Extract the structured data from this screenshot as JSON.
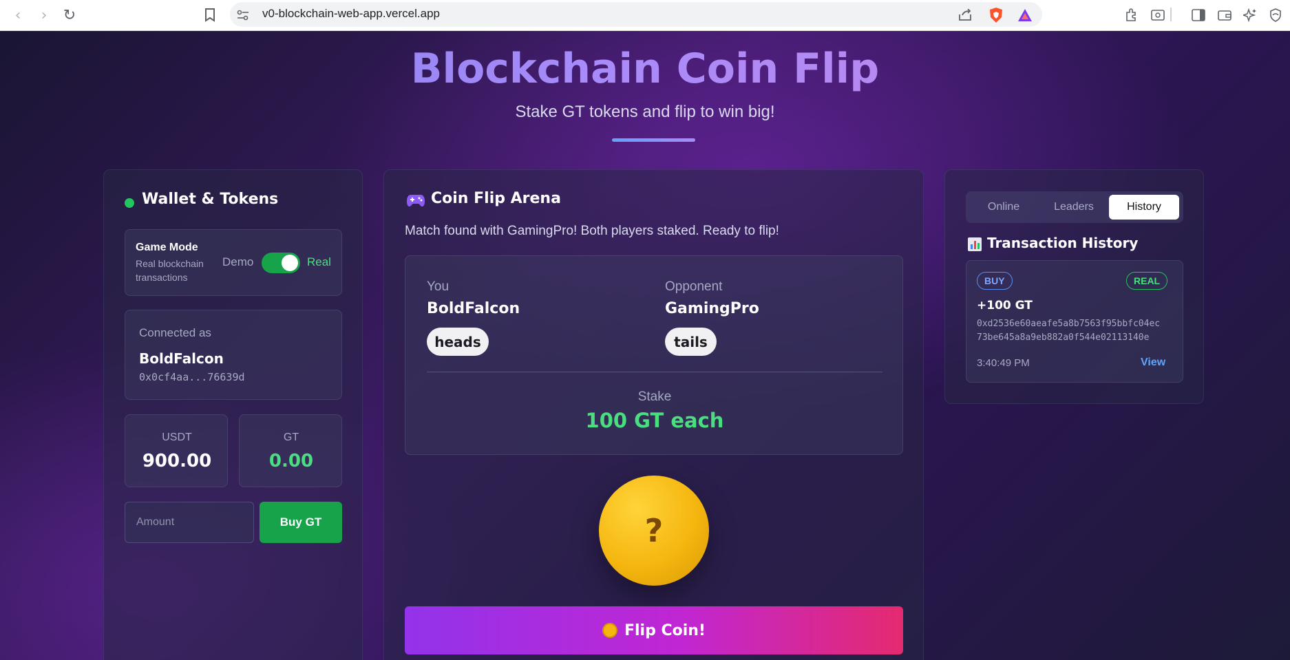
{
  "browser": {
    "url": "v0-blockchain-web-app.vercel.app"
  },
  "header": {
    "title": "Blockchain Coin Flip",
    "subtitle": "Stake GT tokens and flip to win big!"
  },
  "wallet": {
    "title": "Wallet & Tokens",
    "game_mode_label": "Game Mode",
    "game_mode_desc_line1": "Real blockchain",
    "game_mode_desc_line2": "transactions",
    "mode_demo": "Demo",
    "mode_real": "Real",
    "mode_is_real": true,
    "connected_label": "Connected as",
    "username": "BoldFalcon",
    "address": "0x0cf4aa...76639d",
    "usdt_label": "USDT",
    "usdt_value": "900.00",
    "gt_label": "GT",
    "gt_value": "0.00",
    "amount_placeholder": "Amount",
    "buy_label": "Buy GT"
  },
  "arena": {
    "title": "Coin Flip Arena",
    "status": "Match found with GamingPro! Both players staked. Ready to flip!",
    "you_label": "You",
    "you_name": "BoldFalcon",
    "you_choice": "heads",
    "opponent_label": "Opponent",
    "opponent_name": "GamingPro",
    "opponent_choice": "tails",
    "stake_label": "Stake",
    "stake_value": "100 GT each",
    "coin_symbol": "?",
    "flip_label": "Flip Coin!"
  },
  "sidebar": {
    "tabs": [
      {
        "label": "Online",
        "active": false
      },
      {
        "label": "Leaders",
        "active": false
      },
      {
        "label": "History",
        "active": true
      }
    ],
    "history_title": "Transaction History",
    "transactions": [
      {
        "type": "BUY",
        "mode": "REAL",
        "amount": "+100 GT",
        "hash_line1": "0xd2536e60aeafe5a8b7563f95bbfc04ec",
        "hash_line2": "73be645a8a9eb882a0f544e02113140e",
        "time": "3:40:49 PM",
        "view_label": "View"
      }
    ]
  },
  "colors": {
    "accent_green": "#22c55e",
    "accent_purple": "#9333ea",
    "accent_pink": "#e42a6f",
    "coin_gold": "#f5b60f"
  }
}
